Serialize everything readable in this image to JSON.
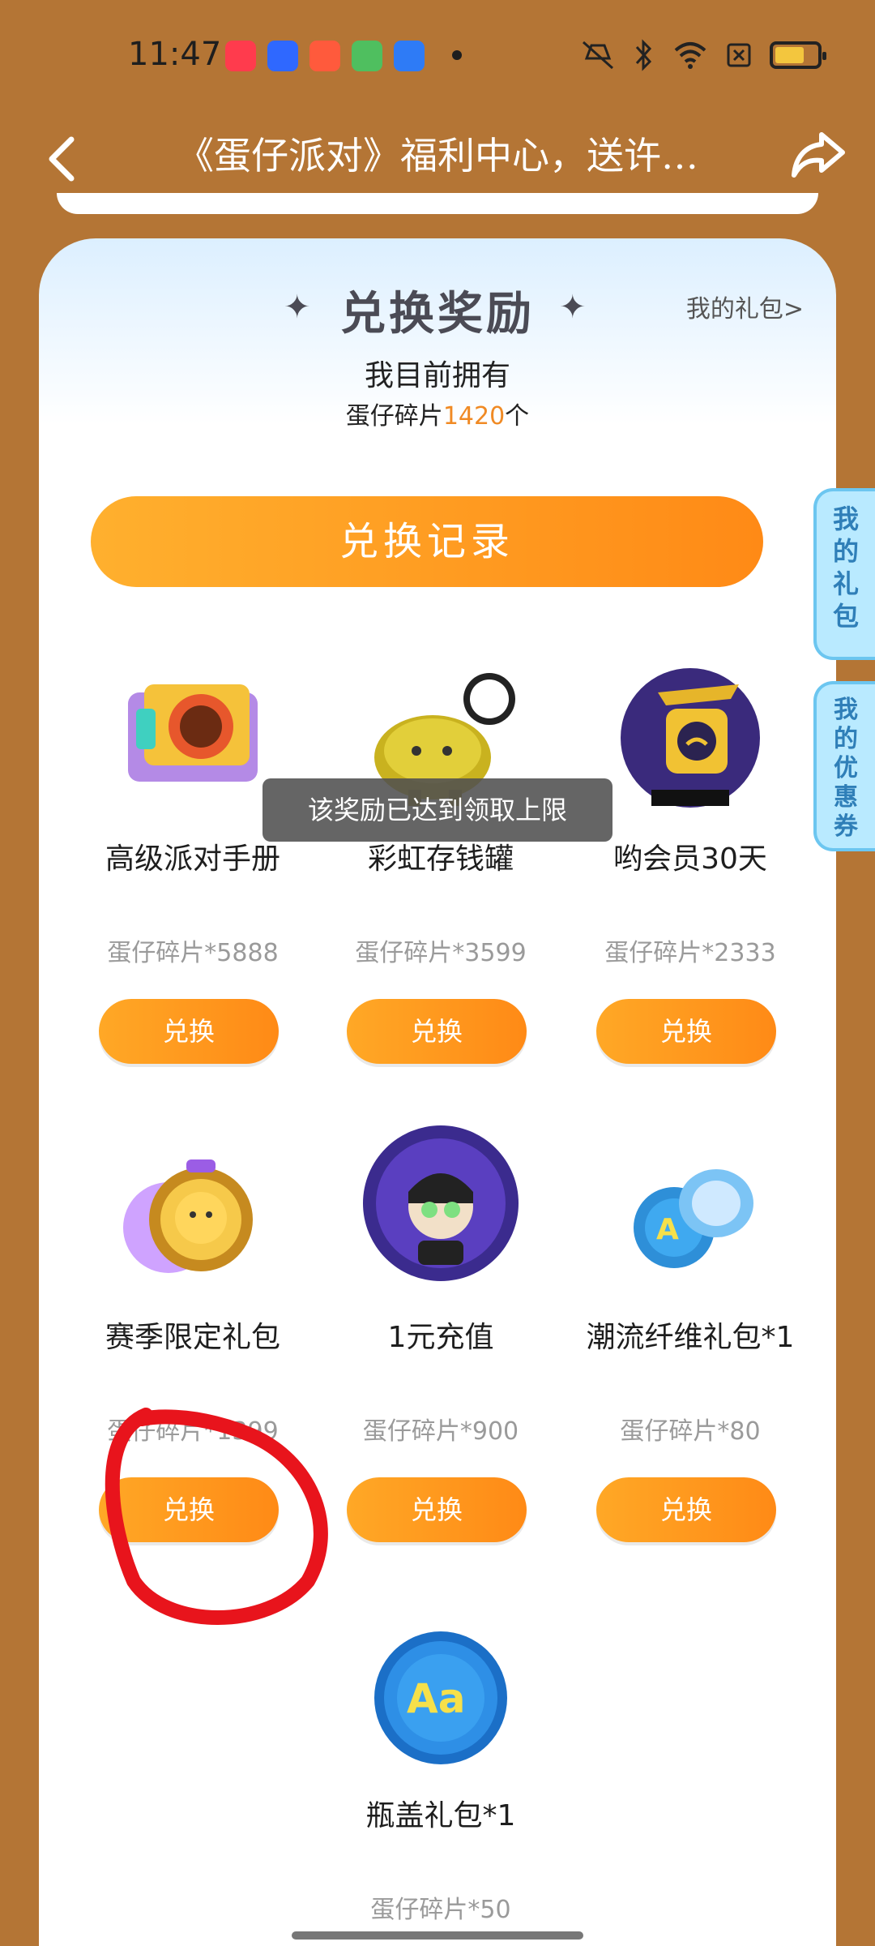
{
  "status_bar": {
    "time": "11:47",
    "icons": [
      "xiaohongshu-app-icon",
      "baidu-app-icon",
      "video-app-icon",
      "player-app-icon",
      "wallet-app-icon",
      "notification-dot",
      "mute-icon",
      "bluetooth-icon",
      "wifi-icon",
      "sim-icon",
      "battery-icon"
    ],
    "app_colors": [
      "#ff3b4d",
      "#2f68ff",
      "#ff5a3c",
      "#4fbf5f",
      "#2e7bf6"
    ],
    "battery_color": "#f3c63e"
  },
  "header": {
    "title": "《蛋仔派对》福利中心，送许…",
    "back_icon": "back-arrow-icon",
    "share_icon": "share-icon"
  },
  "exchange": {
    "section_title": "兑换奖励",
    "my_gift_link": "我的礼包>",
    "owned_title": "我目前拥有",
    "owned_prefix": "蛋仔碎片",
    "owned_count": "1420",
    "owned_suffix": "个",
    "record_button": "兑换记录",
    "items": [
      {
        "name": "高级派对手册",
        "price": "蛋仔碎片*5888",
        "button": "兑换",
        "icon": "party-handbook-icon"
      },
      {
        "name": "彩虹存钱罐",
        "price": "蛋仔碎片*3599",
        "button": "兑换",
        "icon": "piggy-bank-icon"
      },
      {
        "name": "哟会员30天",
        "price": "蛋仔碎片*2333",
        "button": "兑换",
        "icon": "membership-icon"
      },
      {
        "name": "赛季限定礼包",
        "price": "蛋仔碎片*1399",
        "button": "兑换",
        "icon": "season-gift-icon"
      },
      {
        "name": "1元充值",
        "price": "蛋仔碎片*900",
        "button": "兑换",
        "icon": "recharge-icon"
      },
      {
        "name": "潮流纤维礼包*1",
        "price": "蛋仔碎片*80",
        "button": "兑换",
        "icon": "fiber-gift-icon"
      },
      {
        "name": "瓶盖礼包*1",
        "price": "蛋仔碎片*50",
        "icon": "bottle-cap-icon"
      }
    ],
    "toast": "该奖励已达到领取上限"
  },
  "side_tabs": [
    "我的礼包",
    "我的优惠券"
  ],
  "colors": {
    "accent": "#ff8a16",
    "background": "#b47535",
    "tab_blue": "#b9eaff",
    "annotation_red": "#e8141c"
  }
}
